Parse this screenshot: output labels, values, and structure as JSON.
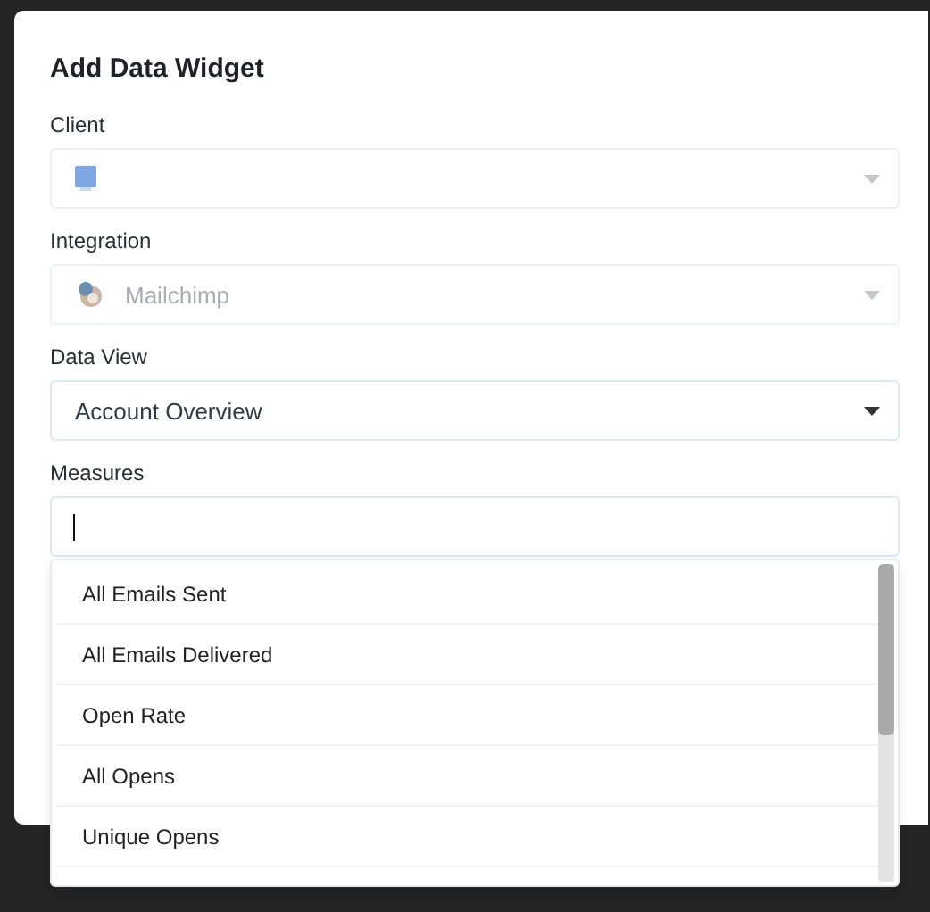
{
  "dialog": {
    "title": "Add Data Widget"
  },
  "fields": [
    {
      "label": "Client",
      "kind": "select",
      "disabled": true
    },
    {
      "label": "Integration",
      "kind": "select",
      "value": "Mailchimp",
      "disabled": true
    },
    {
      "label": "Data View",
      "kind": "select",
      "value": "Account Overview",
      "disabled": false
    },
    {
      "label": "Measures",
      "kind": "search"
    }
  ],
  "menu": {
    "items": [
      {
        "label": "All Emails Sent"
      },
      {
        "label": "All Emails Delivered"
      },
      {
        "label": "Open Rate"
      },
      {
        "label": "All Opens"
      },
      {
        "label": "Unique Opens"
      }
    ]
  }
}
